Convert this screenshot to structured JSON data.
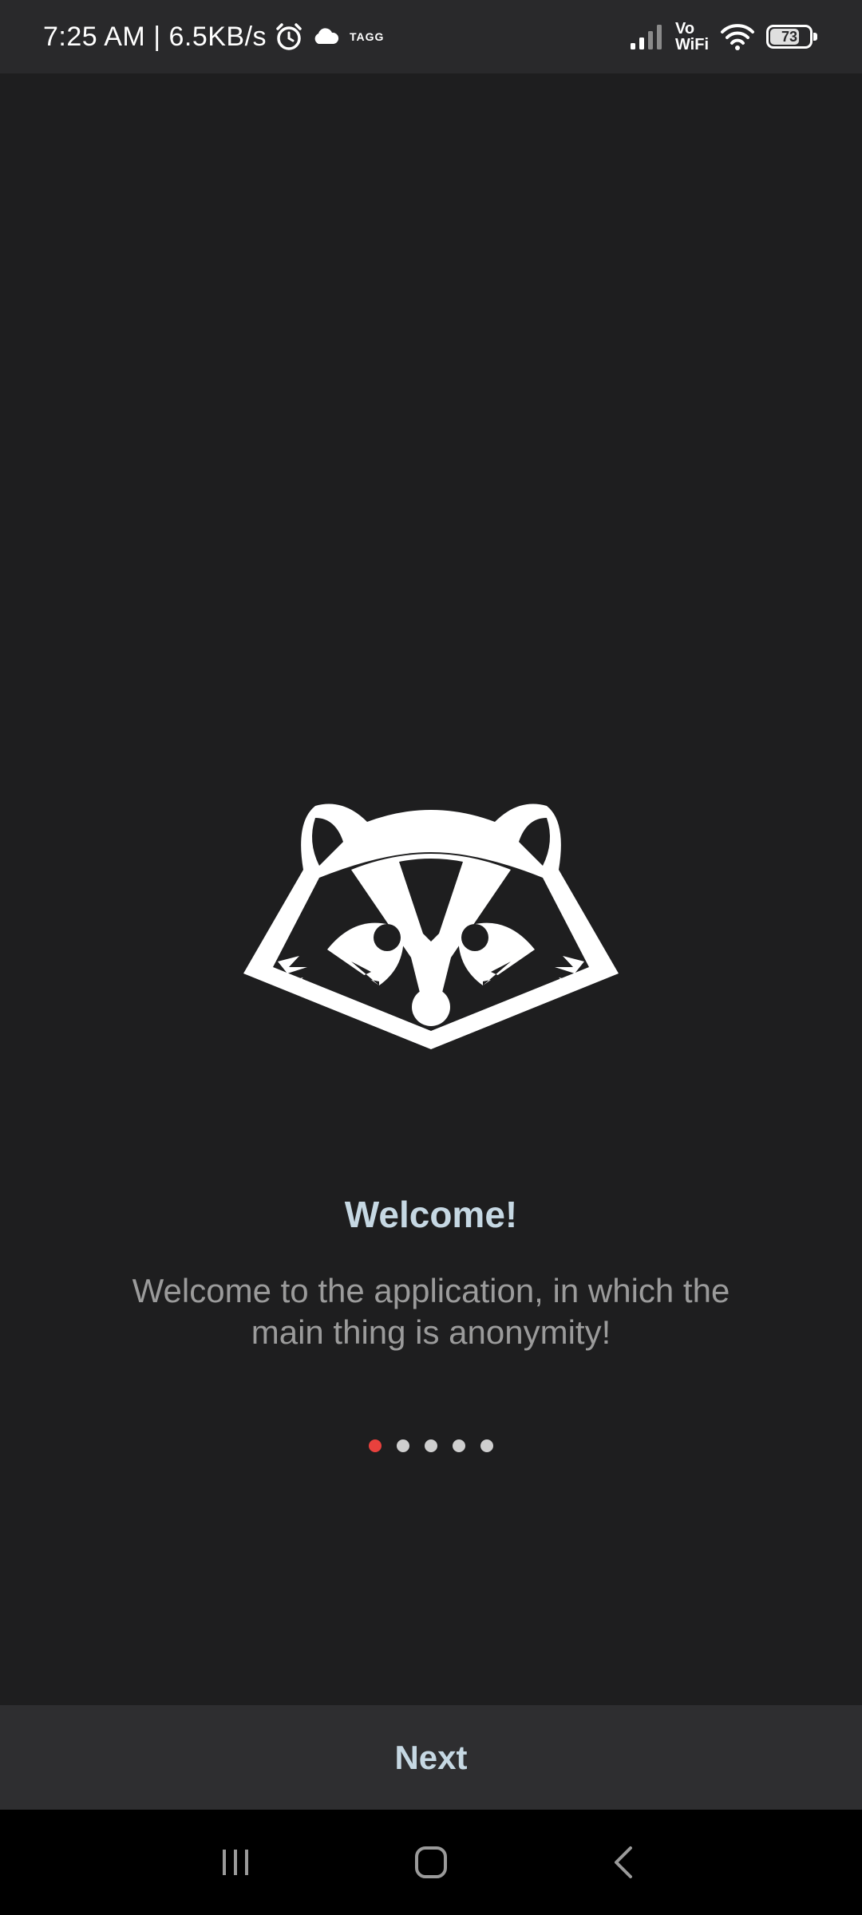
{
  "status_bar": {
    "time": "7:25 AM | 6.5KB/s",
    "tagg_logo_text": "TAGG",
    "vowifi_top": "Vo",
    "vowifi_bottom": "WiFi",
    "battery_level": "73",
    "icons": [
      "alarm-icon",
      "cloud-icon",
      "signal-icon",
      "wifi-icon",
      "battery-icon"
    ]
  },
  "onboarding": {
    "logo": "raccoon-logo",
    "title": "Welcome!",
    "description": "Welcome to the application, in which the main thing is anonymity!",
    "page_count": 5,
    "active_page": 1
  },
  "actions": {
    "next_label": "Next"
  },
  "nav_bar": {
    "icons": [
      "recents-icon",
      "home-icon",
      "back-icon"
    ]
  },
  "colors": {
    "background": "#1e1e1f",
    "status_bar": "#29292b",
    "title": "#c6d8e3",
    "description": "#9b9b9b",
    "dot_active": "#e8413d",
    "dot_inactive": "#cfcfcf",
    "next_bar": "#2e2e30"
  }
}
